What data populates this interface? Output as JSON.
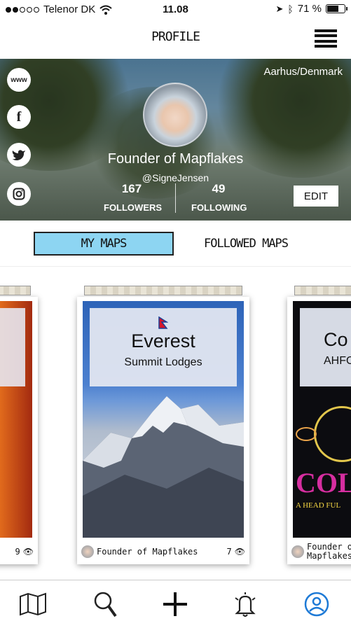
{
  "status_bar": {
    "carrier": "Telenor DK",
    "time": "11.08",
    "battery": "71 %",
    "battery_level": 0.71
  },
  "header": {
    "title": "PROFILE"
  },
  "hero": {
    "location": "Aarhus/Denmark",
    "name": "Founder of Mapflakes",
    "handle": "@SigneJensen",
    "followers_count": "167",
    "followers_label": "FOLLOWERS",
    "following_count": "49",
    "following_label": "FOLLOWING",
    "edit_label": "EDIT",
    "social": {
      "web_label": "www",
      "facebook_label": "f"
    }
  },
  "tabs": {
    "my_maps": "MY MAPS",
    "followed_maps": "FOLLOWED MAPS"
  },
  "cards": {
    "left": {
      "views": "9"
    },
    "center": {
      "title": "Everest",
      "subtitle": "Summit Lodges",
      "author": "Founder of Mapflakes",
      "views": "7"
    },
    "right": {
      "title": "Co",
      "subtitle": "AHFO",
      "author_line1": "Founder o",
      "author_line2": "Mapflakes",
      "banner": "COL",
      "banner_sub": "A HEAD FUL"
    }
  },
  "colors": {
    "active_tab": "#8dd5f2",
    "accent_blue": "#1e7ad6"
  }
}
